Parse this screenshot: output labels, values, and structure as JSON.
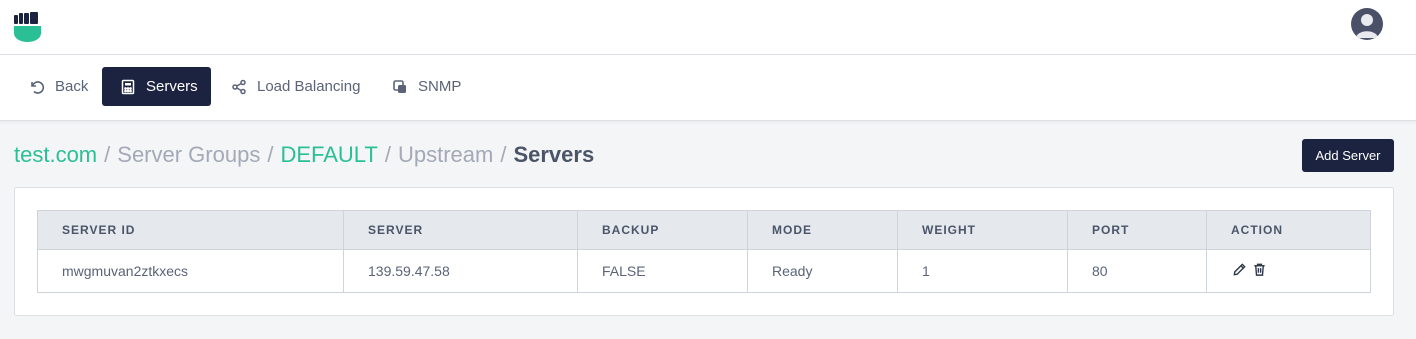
{
  "header": {
    "logo_icon": "fist-shield-logo-icon",
    "avatar_icon": "user-avatar-icon",
    "brand_color": "#2bbf95"
  },
  "nav": {
    "back": "Back",
    "servers": "Servers",
    "load_balancing": "Load Balancing",
    "snmp": "SNMP",
    "active_color": "#1c2340"
  },
  "breadcrumb": {
    "items": [
      "test.com",
      "Server Groups",
      "DEFAULT",
      "Upstream"
    ],
    "separator": "/",
    "current": "Servers"
  },
  "add_server_label": "Add Server",
  "table": {
    "columns": [
      "SERVER ID",
      "SERVER",
      "BACKUP",
      "MODE",
      "WEIGHT",
      "PORT",
      "ACTION"
    ],
    "rows": [
      {
        "server_id": "mwgmuvan2ztkxecs",
        "server": "139.59.47.58",
        "backup": "FALSE",
        "mode": "Ready",
        "weight": "1",
        "port": "80",
        "actions": [
          "edit-icon",
          "delete-icon"
        ]
      }
    ]
  }
}
